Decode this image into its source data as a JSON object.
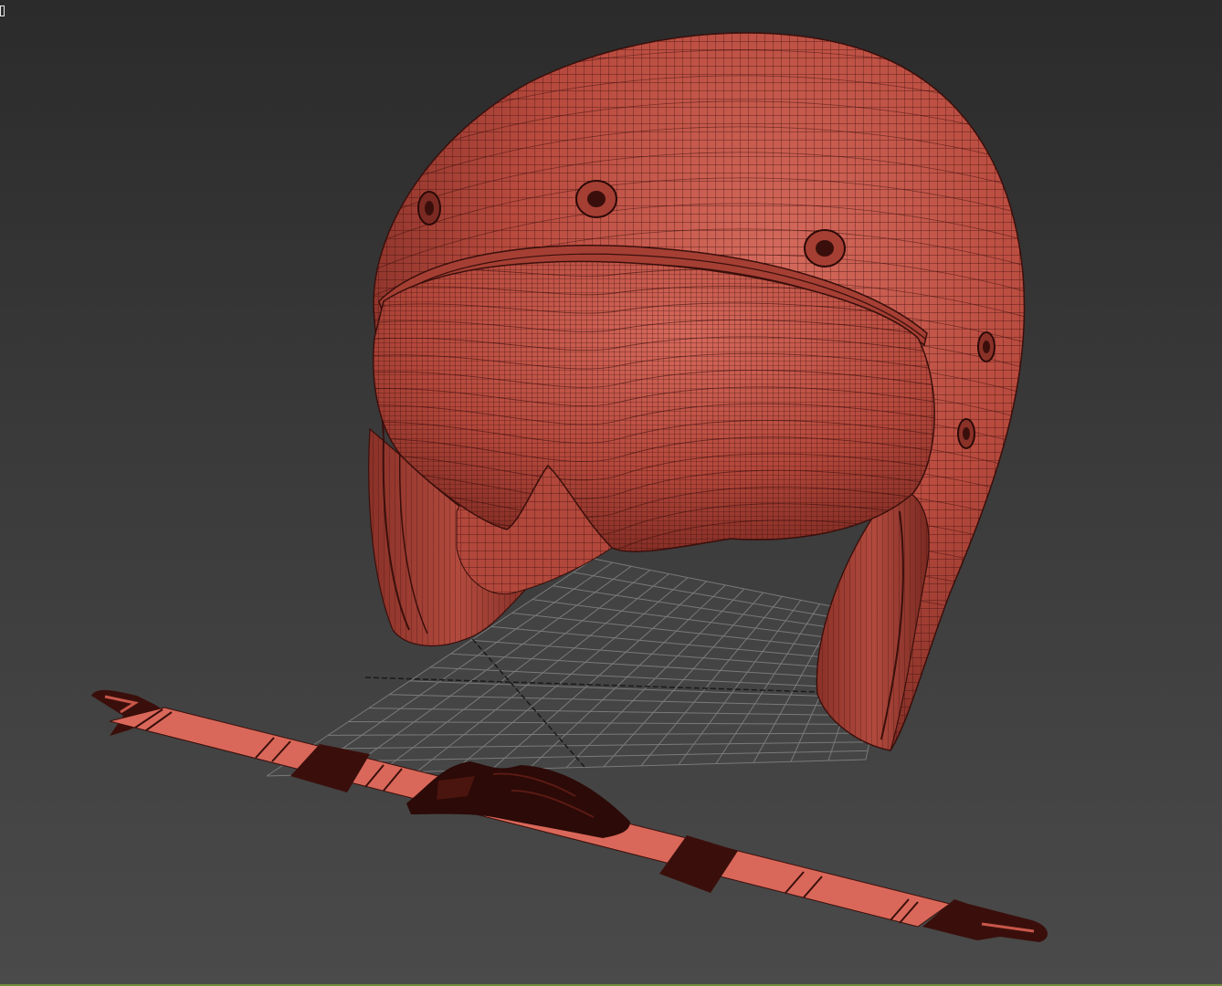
{
  "viewport": {
    "label": "",
    "background_top": "#2b2b2b",
    "background_bottom": "#4a4a4a"
  },
  "scene": {
    "object_color": "#c8574a",
    "wire_color": "#3a0f0b",
    "grid_color": "#8c8c8c",
    "grid_axis_color": "#1a1a1a",
    "objects": [
      "helmet-shell",
      "helmet-visor",
      "chin-strap",
      "strap-buckle",
      "home-grid"
    ]
  }
}
